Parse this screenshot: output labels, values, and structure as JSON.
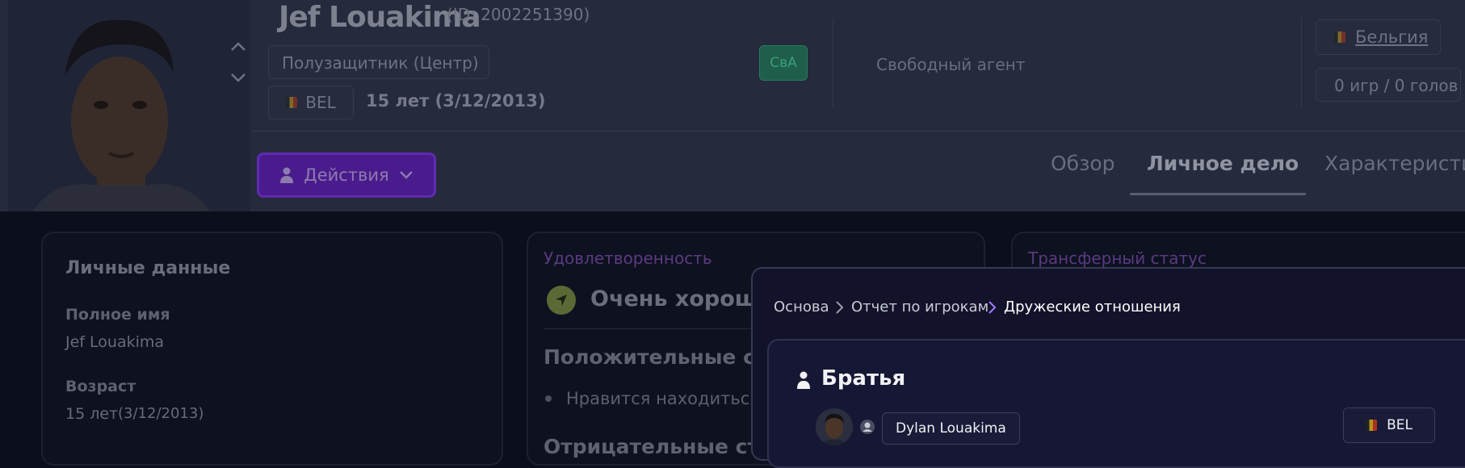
{
  "player": {
    "name": "Jef Louakima",
    "id_text": "(ID: 2002251390)",
    "position": "Полузащитник (Центр)",
    "nationality_code": "BEL",
    "age_text": "15 лет (3/12/2013)",
    "role_badge": "СвА",
    "contract_status": "Свободный агент",
    "country": "Бельгия",
    "caps": "0 игр / 0 голов"
  },
  "actions_button": {
    "label": "Действия"
  },
  "tabs": [
    {
      "label": "Обзор",
      "active": false
    },
    {
      "label": "Личное дело",
      "active": true
    },
    {
      "label": "Характеристик",
      "active": false
    }
  ],
  "personal_card": {
    "title": "Личные данные",
    "full_name_label": "Полное имя",
    "full_name_value": "Jef Louakima",
    "age_label": "Возраст",
    "age_years": "15 лет",
    "age_date": "(3/12/2013)"
  },
  "satisfaction_card": {
    "title": "Удовлетворенность",
    "status": "Очень хороши",
    "positive_header": "Положительные ст",
    "positive_item": "Нравится находиться",
    "negative_header": "Отрицательные ст"
  },
  "transfer_card": {
    "title": "Трансферный статус"
  },
  "overlay": {
    "breadcrumb": [
      "Основа",
      "Отчет по игрокам",
      "Дружеские отношения"
    ],
    "section_title": "Братья",
    "relative": {
      "name": "Dylan Louakima",
      "nationality": "BEL"
    }
  },
  "colors": {
    "accent_purple": "#5e2bb0",
    "role_badge_green": "#1e5e4a",
    "background": "#0b0e1c",
    "header": "#252a3c"
  }
}
